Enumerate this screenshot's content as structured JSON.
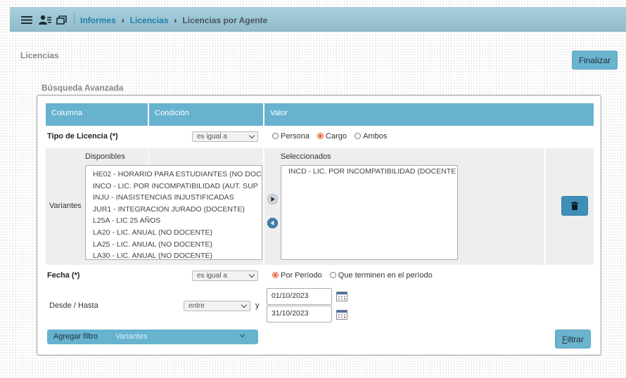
{
  "breadcrumb": {
    "items": [
      "Informes",
      "Licencias"
    ],
    "current": "Licencias por Agente"
  },
  "section_title": "Licencias",
  "finalizar_label": "Finalizar",
  "advanced_title": "Búsqueda Avanzada",
  "table": {
    "headers": [
      "Columna",
      "Condición",
      "Valor"
    ],
    "tipo": {
      "label": "Tipo de Licencia (*)",
      "condition": "es igual a",
      "options": [
        "Persona",
        "Cargo",
        "Ambos"
      ],
      "selected": "Cargo"
    },
    "variantes": {
      "label": "Variantes",
      "disponibles_label": "Disponibles",
      "seleccionados_label": "Seleccionados",
      "disponibles": [
        "HE02 - HORARIO PARA ESTUDIANTES (NO DOC",
        "INCO - LIC. POR INCOMPATIBILIDAD (AUT. SUP",
        "INJU - INASISTENCIAS INJUSTIFICADAS",
        "JUR1 - INTEGRACION JURADO (DOCENTE)",
        "L25A - LIC 25 AÑOS",
        "LA20 - LIC. ANUAL (NO DOCENTE)",
        "LA25 - LIC. ANUAL (NO DOCENTE)",
        "LA30 - LIC. ANUAL (NO DOCENTE)"
      ],
      "seleccionados": [
        "INCD - LIC. POR INCOMPATIBILIDAD (DOCENTE"
      ]
    },
    "fecha": {
      "label": "Fecha (*)",
      "condition": "es igual a",
      "options": [
        "Por Período",
        "Que terminen en el período"
      ],
      "selected": "Por Período"
    },
    "desde_hasta": {
      "label": "Desde / Hasta",
      "condition": "entre",
      "joiner": "y",
      "desde": "01/10/2023",
      "hasta": "31/10/2023"
    }
  },
  "agregar_filtro": {
    "label": "Agregar filtro",
    "value": "Variantes"
  },
  "filtrar_label": "Filtrar",
  "colors": {
    "header": "#66b2cf",
    "topbar": "#9cc6d6",
    "button": "#6bb4cf",
    "radio_selected": "#e8622f"
  },
  "icons": [
    "menu-icon",
    "user-list-icon",
    "windows-icon",
    "chevron-right-icon",
    "add-icon",
    "remove-icon",
    "trash-icon",
    "calendar-icon",
    "chevron-down-icon"
  ]
}
